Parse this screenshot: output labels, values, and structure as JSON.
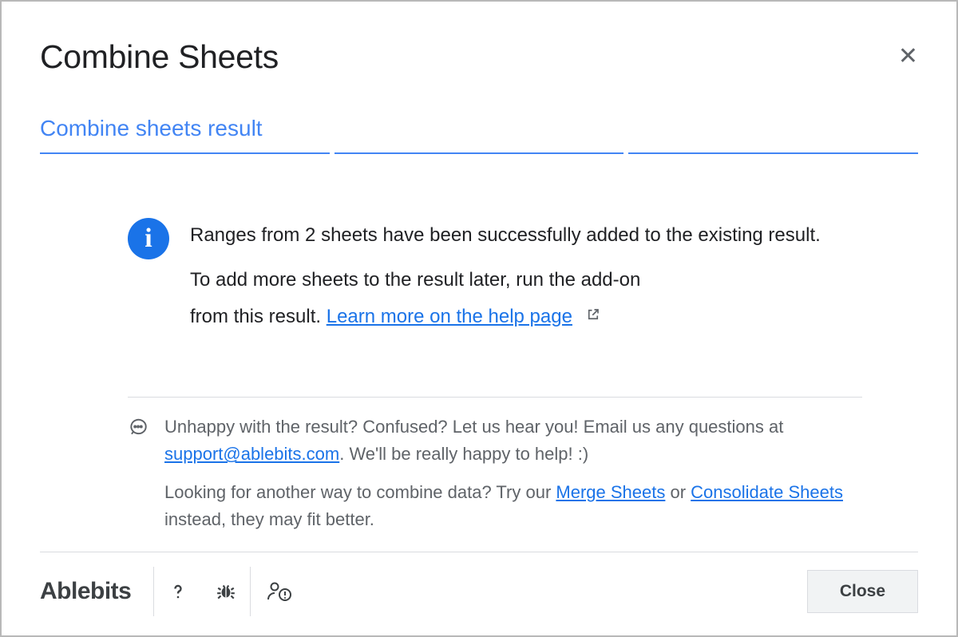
{
  "dialog": {
    "title": "Combine Sheets",
    "tabs": [
      {
        "label": "Combine sheets result"
      },
      {
        "label": ""
      },
      {
        "label": ""
      }
    ]
  },
  "message": {
    "line1": "Ranges from 2 sheets have been successfully added to the existing result.",
    "line2a": "To add more sheets to the result later, run the add-on",
    "line2b_prefix": "from this result. ",
    "learn_more": "Learn more on the help page"
  },
  "feedback": {
    "p1_prefix": "Unhappy with the result? Confused? Let us hear you! Email us any questions at ",
    "support_email": "support@ablebits.com",
    "p1_suffix": ". We'll be really happy to help! :)",
    "p2_prefix": "Looking for another way to combine data? Try our ",
    "merge_link": "Merge Sheets",
    "p2_mid": " or ",
    "consolidate_link": "Consolidate Sheets",
    "p2_suffix": " instead, they may fit better."
  },
  "footer": {
    "brand": "Ablebits",
    "close": "Close"
  }
}
